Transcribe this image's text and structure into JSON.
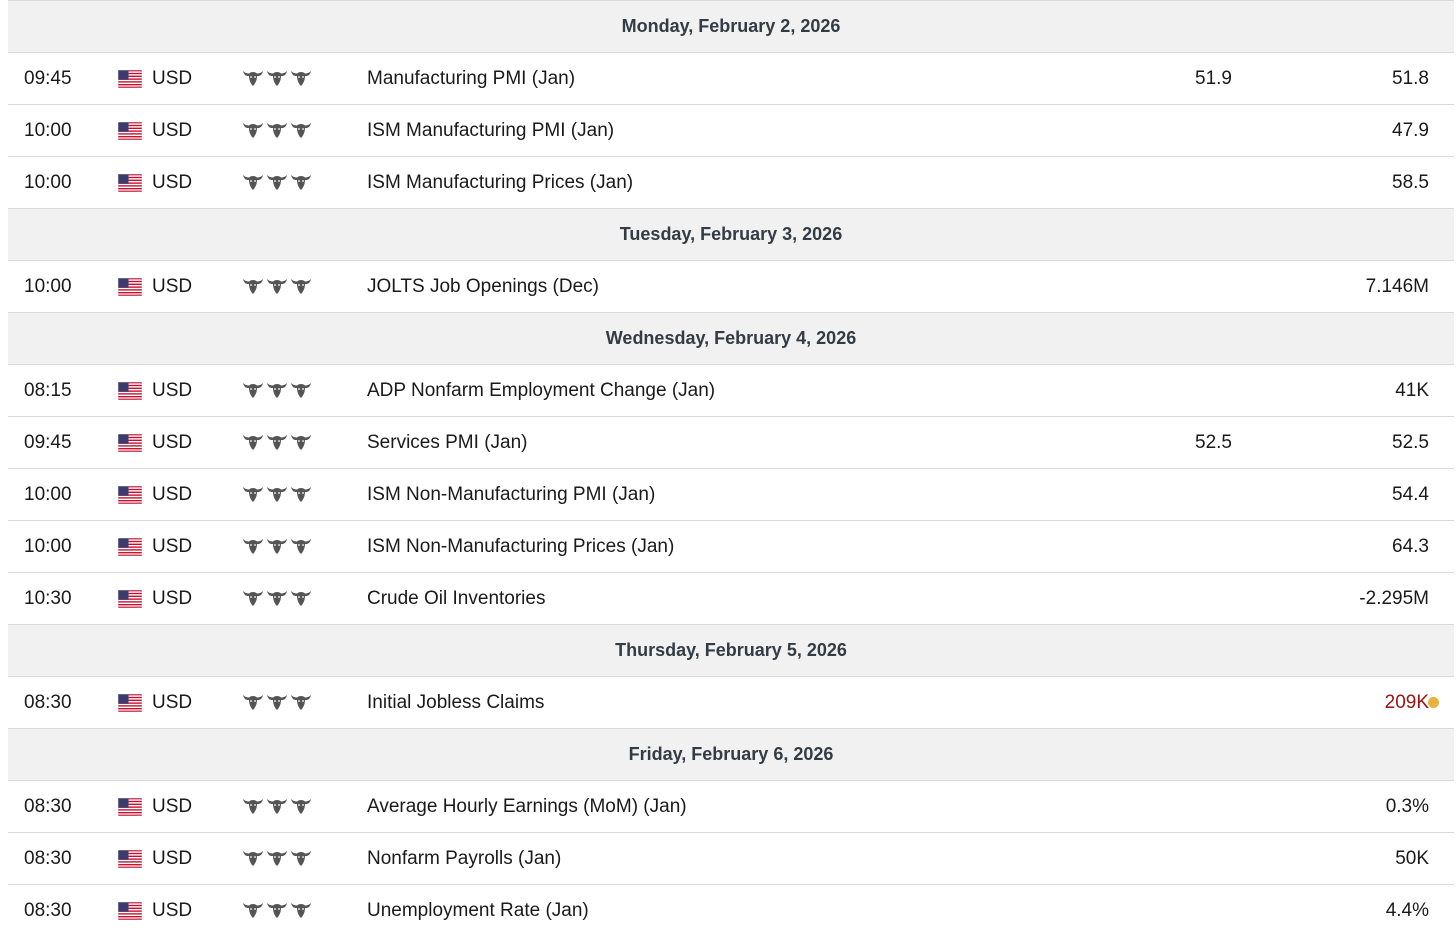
{
  "colors": {
    "day_header_bg": "#f1f1f1",
    "day_header_text": "#333b45",
    "divider": "#d9d9d9",
    "bull_icon": "#555555",
    "highlight_value": "#9b1212",
    "status_dot": "#e8b23c"
  },
  "icons": {
    "flag": "us-flag-icon",
    "importance": "bull-icon"
  },
  "days": [
    {
      "label": "Monday, February 2, 2026",
      "events": [
        {
          "time": "09:45",
          "currency": "USD",
          "importance": 3,
          "event": "Manufacturing PMI (Jan)",
          "actual": "51.9",
          "forecast": "51.8"
        },
        {
          "time": "10:00",
          "currency": "USD",
          "importance": 3,
          "event": "ISM Manufacturing PMI (Jan)",
          "actual": "",
          "forecast": "47.9"
        },
        {
          "time": "10:00",
          "currency": "USD",
          "importance": 3,
          "event": "ISM Manufacturing Prices (Jan)",
          "actual": "",
          "forecast": "58.5"
        }
      ]
    },
    {
      "label": "Tuesday, February 3, 2026",
      "events": [
        {
          "time": "10:00",
          "currency": "USD",
          "importance": 3,
          "event": "JOLTS Job Openings (Dec)",
          "actual": "",
          "forecast": "7.146M"
        }
      ]
    },
    {
      "label": "Wednesday, February 4, 2026",
      "events": [
        {
          "time": "08:15",
          "currency": "USD",
          "importance": 3,
          "event": "ADP Nonfarm Employment Change (Jan)",
          "actual": "",
          "forecast": "41K"
        },
        {
          "time": "09:45",
          "currency": "USD",
          "importance": 3,
          "event": "Services PMI (Jan)",
          "actual": "52.5",
          "forecast": "52.5"
        },
        {
          "time": "10:00",
          "currency": "USD",
          "importance": 3,
          "event": "ISM Non-Manufacturing PMI (Jan)",
          "actual": "",
          "forecast": "54.4"
        },
        {
          "time": "10:00",
          "currency": "USD",
          "importance": 3,
          "event": "ISM Non-Manufacturing Prices (Jan)",
          "actual": "",
          "forecast": "64.3"
        },
        {
          "time": "10:30",
          "currency": "USD",
          "importance": 3,
          "event": "Crude Oil Inventories",
          "actual": "",
          "forecast": "-2.295M"
        }
      ]
    },
    {
      "label": "Thursday, February 5, 2026",
      "events": [
        {
          "time": "08:30",
          "currency": "USD",
          "importance": 3,
          "event": "Initial Jobless Claims",
          "actual": "",
          "forecast": "209K",
          "highlight": true,
          "dot": true
        }
      ]
    },
    {
      "label": "Friday, February 6, 2026",
      "events": [
        {
          "time": "08:30",
          "currency": "USD",
          "importance": 3,
          "event": "Average Hourly Earnings (MoM) (Jan)",
          "actual": "",
          "forecast": "0.3%"
        },
        {
          "time": "08:30",
          "currency": "USD",
          "importance": 3,
          "event": "Nonfarm Payrolls (Jan)",
          "actual": "",
          "forecast": "50K"
        },
        {
          "time": "08:30",
          "currency": "USD",
          "importance": 3,
          "event": "Unemployment Rate (Jan)",
          "actual": "",
          "forecast": "4.4%"
        }
      ]
    }
  ]
}
